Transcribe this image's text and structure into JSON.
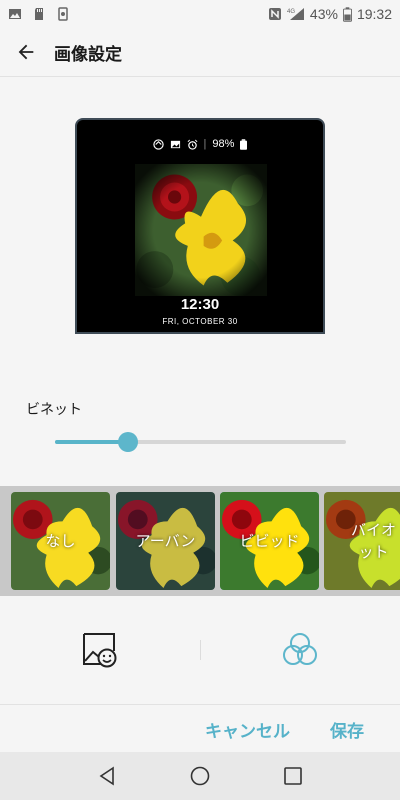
{
  "status_bar": {
    "left_icons": [
      "gallery-icon",
      "sd-card-icon",
      "vibrate-icon"
    ],
    "right_icons": [
      "nfc-icon",
      "4g-signal-icon",
      "battery-icon"
    ],
    "battery_percent": "43%",
    "time": "19:32"
  },
  "header": {
    "title": "画像設定"
  },
  "preview": {
    "status_icons": [
      "sync-icon",
      "image-icon",
      "alarm-icon"
    ],
    "battery": "98%",
    "time": "12:30",
    "date": "FRI, OCTOBER 30"
  },
  "vignette": {
    "label": "ビネット",
    "value": 0.25
  },
  "filters": [
    {
      "label": "なし",
      "selected": false
    },
    {
      "label": "アーバン",
      "selected": false
    },
    {
      "label": "ビビッド",
      "selected": true
    },
    {
      "label": "バイオ\nット",
      "selected": false
    }
  ],
  "tools": [
    "image-sticker-icon",
    "color-filter-icon"
  ],
  "actions": {
    "cancel": "キャンセル",
    "save": "保存"
  },
  "colors": {
    "accent": "#5db6cb",
    "preview_frame": "#3f4c57"
  }
}
